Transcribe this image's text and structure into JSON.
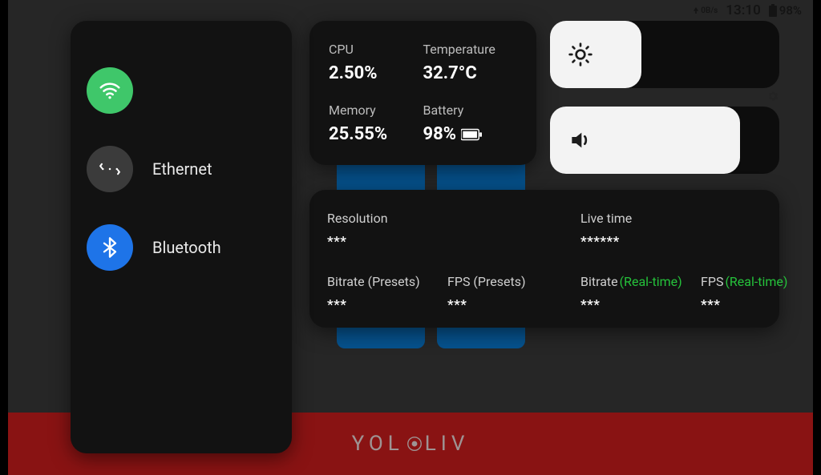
{
  "statusbar": {
    "net_up": "0B/s",
    "clock": "13:10",
    "battery": "98%"
  },
  "brand": {
    "name": "YOLOLIV"
  },
  "connections": {
    "wifi_label": "",
    "ethernet_label": "Ethernet",
    "bluetooth_label": "Bluetooth"
  },
  "stats": {
    "cpu_label": "CPU",
    "cpu_value": "2.50%",
    "temp_label": "Temperature",
    "temp_value": "32.7°C",
    "mem_label": "Memory",
    "mem_value": "25.55%",
    "batt_label": "Battery",
    "batt_value": "98%"
  },
  "sliders": {
    "brightness_pct": 40,
    "volume_pct": 83
  },
  "stream": {
    "res_label": "Resolution",
    "res_value": "***",
    "bitrate_preset_label": "Bitrate (Presets)",
    "bitrate_preset_value": "***",
    "fps_preset_label": "FPS (Presets)",
    "fps_preset_value": "***",
    "livetime_label": "Live time",
    "livetime_value": "******",
    "bitrate_rt_label_a": "Bitrate",
    "bitrate_rt_label_b": "(Real-time)",
    "bitrate_rt_value": "***",
    "fps_rt_label_a": "FPS ",
    "fps_rt_label_b": "(Real-time)",
    "fps_rt_value": "***"
  }
}
